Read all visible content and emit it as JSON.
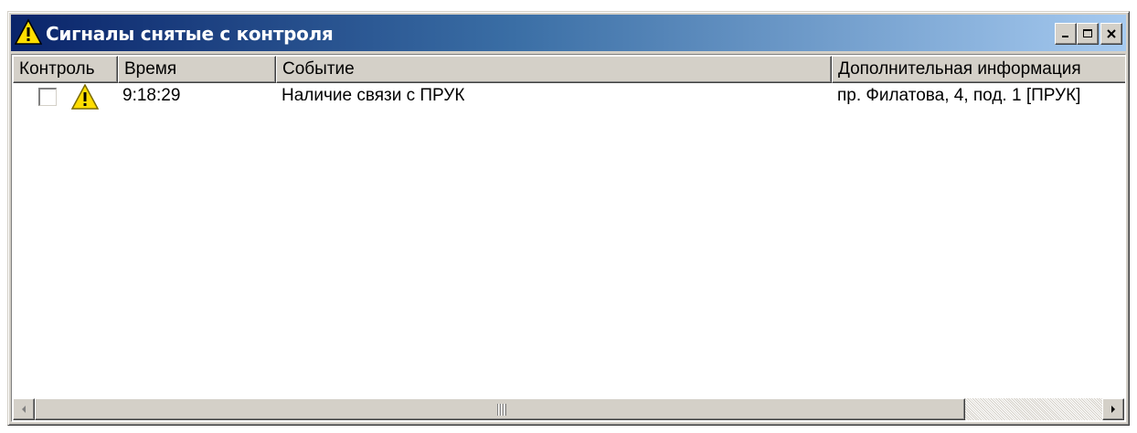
{
  "window": {
    "title": "Сигналы снятые с контроля",
    "icon": "warning-triangle-icon",
    "buttons": [
      "minimize-icon",
      "maximize-icon",
      "close-icon"
    ]
  },
  "table": {
    "columns": [
      {
        "key": "control",
        "label": "Контроль"
      },
      {
        "key": "time",
        "label": "Время"
      },
      {
        "key": "event",
        "label": "Событие"
      },
      {
        "key": "info",
        "label": "Дополнительная информация"
      }
    ],
    "rows": [
      {
        "checked": false,
        "icon": "warning-triangle-icon",
        "time": "9:18:29",
        "event": "Наличие связи с ПРУК",
        "info": "пр. Филатова, 4, под. 1 [ПРУК]"
      }
    ]
  },
  "colors": {
    "title_gradient_start": "#0a246a",
    "title_gradient_end": "#a6caf0",
    "face": "#d4d0c8",
    "warning_yellow": "#ffdd00"
  }
}
